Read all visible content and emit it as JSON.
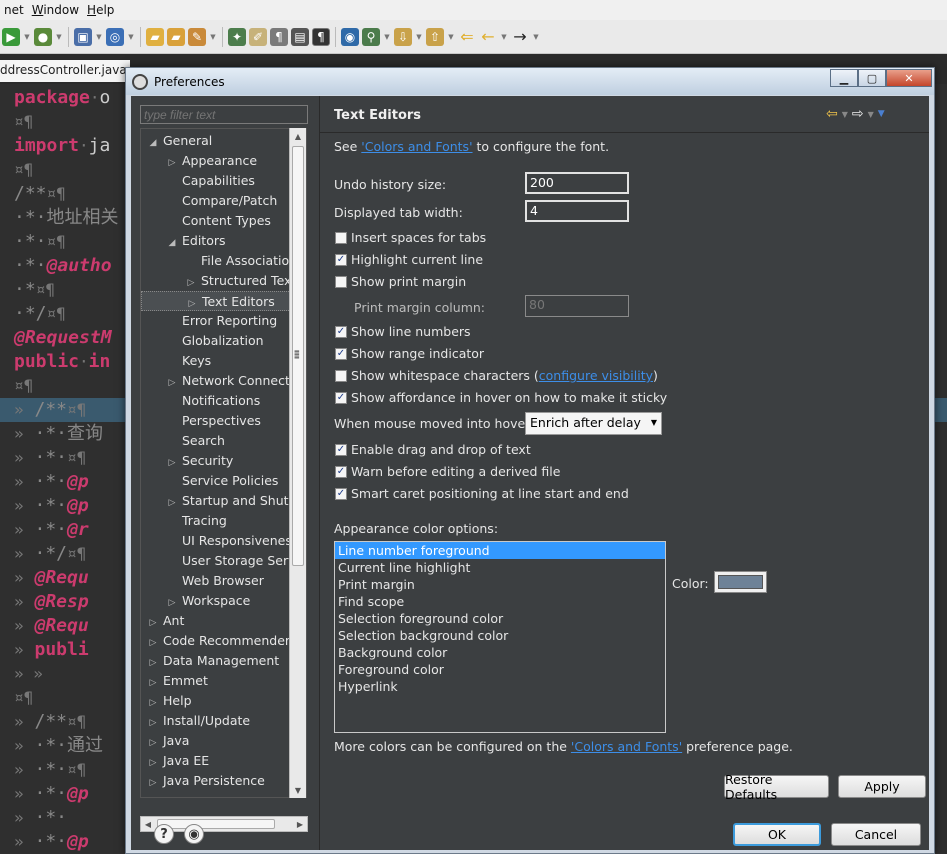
{
  "menubar": {
    "items": [
      "net",
      "Window",
      "Help"
    ]
  },
  "editor": {
    "tab_label": "ddressController.java",
    "lines": [
      {
        "parts": [
          [
            "kw",
            "package"
          ],
          [
            "para",
            "·"
          ],
          [
            "txt",
            "o"
          ]
        ]
      },
      {
        "parts": [
          [
            "para",
            "¤¶"
          ]
        ]
      },
      {
        "parts": [
          [
            "kw",
            "import"
          ],
          [
            "para",
            "·"
          ],
          [
            "txt",
            "ja"
          ]
        ]
      },
      {
        "parts": [
          [
            "para",
            "¤¶"
          ]
        ]
      },
      {
        "parts": [
          [
            "cm",
            "/**"
          ],
          [
            "para",
            "¤¶"
          ]
        ]
      },
      {
        "parts": [
          [
            "cm",
            "·*·地址相关"
          ]
        ]
      },
      {
        "parts": [
          [
            "cm",
            "·*·"
          ],
          [
            "para",
            "¤¶"
          ]
        ]
      },
      {
        "parts": [
          [
            "cm",
            "·*·"
          ],
          [
            "ann",
            "@autho"
          ]
        ]
      },
      {
        "parts": [
          [
            "cm",
            "·*"
          ],
          [
            "para",
            "¤¶"
          ]
        ]
      },
      {
        "parts": [
          [
            "cm",
            "·*/"
          ],
          [
            "para",
            "¤¶"
          ]
        ]
      },
      {
        "parts": [
          [
            "ann",
            "@RequestM"
          ]
        ]
      },
      {
        "parts": [
          [
            "kw",
            "public"
          ],
          [
            "para",
            "·"
          ],
          [
            "kw",
            "in"
          ]
        ]
      },
      {
        "parts": [
          [
            "para",
            "¤¶"
          ]
        ]
      },
      {
        "parts": [
          [
            "para",
            "»"
          ],
          [
            "cm",
            "   /**"
          ],
          [
            "para",
            "¤¶"
          ]
        ]
      },
      {
        "parts": [
          [
            "para",
            "»"
          ],
          [
            "cm",
            "    ·*·查询"
          ]
        ]
      },
      {
        "parts": [
          [
            "para",
            "»"
          ],
          [
            "cm",
            "    ·*·"
          ],
          [
            "para",
            "¤¶"
          ]
        ]
      },
      {
        "parts": [
          [
            "para",
            "»"
          ],
          [
            "cm",
            "    ·*·"
          ],
          [
            "ann",
            "@p"
          ]
        ]
      },
      {
        "parts": [
          [
            "para",
            "»"
          ],
          [
            "cm",
            "    ·*·"
          ],
          [
            "ann",
            "@p"
          ]
        ]
      },
      {
        "parts": [
          [
            "para",
            "»"
          ],
          [
            "cm",
            "    ·*·"
          ],
          [
            "ann",
            "@r"
          ]
        ]
      },
      {
        "parts": [
          [
            "para",
            "»"
          ],
          [
            "cm",
            "    ·*/"
          ],
          [
            "para",
            "¤¶"
          ]
        ]
      },
      {
        "parts": [
          [
            "para",
            "»"
          ],
          [
            "ann",
            "  @Requ"
          ]
        ]
      },
      {
        "parts": [
          [
            "para",
            "»"
          ],
          [
            "ann",
            "  @Resp"
          ]
        ]
      },
      {
        "parts": [
          [
            "para",
            "»"
          ],
          [
            "ann",
            "  @Requ"
          ]
        ]
      },
      {
        "parts": [
          [
            "para",
            "»"
          ],
          [
            "kw",
            "  publi"
          ]
        ]
      },
      {
        "parts": [
          [
            "para",
            "»     »"
          ]
        ]
      },
      {
        "parts": [
          [
            "para",
            "¤¶"
          ]
        ]
      },
      {
        "parts": [
          [
            "para",
            "»"
          ],
          [
            "cm",
            "   /**"
          ],
          [
            "para",
            "¤¶"
          ]
        ]
      },
      {
        "parts": [
          [
            "para",
            "»"
          ],
          [
            "cm",
            "    ·*·通过"
          ]
        ]
      },
      {
        "parts": [
          [
            "para",
            "»"
          ],
          [
            "cm",
            "    ·*·"
          ],
          [
            "para",
            "¤¶"
          ]
        ]
      },
      {
        "parts": [
          [
            "para",
            "»"
          ],
          [
            "cm",
            "    ·*·"
          ],
          [
            "ann",
            "@p"
          ]
        ]
      },
      {
        "parts": [
          [
            "para",
            "»"
          ],
          [
            "cm",
            "    ·*·"
          ]
        ]
      },
      {
        "parts": [
          [
            "para",
            "»"
          ],
          [
            "cm",
            "    ·*·"
          ],
          [
            "ann",
            "@p"
          ]
        ]
      }
    ]
  },
  "dialog": {
    "title": "Preferences",
    "filter_placeholder": "type filter text",
    "tree": [
      {
        "label": "General",
        "level": 0,
        "twisty": "◢"
      },
      {
        "label": "Appearance",
        "level": 1,
        "twisty": "▷"
      },
      {
        "label": "Capabilities",
        "level": 1,
        "twisty": ""
      },
      {
        "label": "Compare/Patch",
        "level": 1,
        "twisty": ""
      },
      {
        "label": "Content Types",
        "level": 1,
        "twisty": ""
      },
      {
        "label": "Editors",
        "level": 1,
        "twisty": "◢"
      },
      {
        "label": "File Associations",
        "level": 2,
        "twisty": ""
      },
      {
        "label": "Structured Text",
        "level": 2,
        "twisty": "▷"
      },
      {
        "label": "Text Editors",
        "level": 2,
        "twisty": "▷",
        "selected": true
      },
      {
        "label": "Error Reporting",
        "level": 1,
        "twisty": ""
      },
      {
        "label": "Globalization",
        "level": 1,
        "twisty": ""
      },
      {
        "label": "Keys",
        "level": 1,
        "twisty": ""
      },
      {
        "label": "Network Connections",
        "level": 1,
        "twisty": "▷"
      },
      {
        "label": "Notifications",
        "level": 1,
        "twisty": ""
      },
      {
        "label": "Perspectives",
        "level": 1,
        "twisty": ""
      },
      {
        "label": "Search",
        "level": 1,
        "twisty": ""
      },
      {
        "label": "Security",
        "level": 1,
        "twisty": "▷"
      },
      {
        "label": "Service Policies",
        "level": 1,
        "twisty": ""
      },
      {
        "label": "Startup and Shutdown",
        "level": 1,
        "twisty": "▷"
      },
      {
        "label": "Tracing",
        "level": 1,
        "twisty": ""
      },
      {
        "label": "UI Responsiveness",
        "level": 1,
        "twisty": ""
      },
      {
        "label": "User Storage Service",
        "level": 1,
        "twisty": ""
      },
      {
        "label": "Web Browser",
        "level": 1,
        "twisty": ""
      },
      {
        "label": "Workspace",
        "level": 1,
        "twisty": "▷"
      },
      {
        "label": "Ant",
        "level": 0,
        "twisty": "▷"
      },
      {
        "label": "Code Recommenders",
        "level": 0,
        "twisty": "▷"
      },
      {
        "label": "Data Management",
        "level": 0,
        "twisty": "▷"
      },
      {
        "label": "Emmet",
        "level": 0,
        "twisty": "▷"
      },
      {
        "label": "Help",
        "level": 0,
        "twisty": "▷"
      },
      {
        "label": "Install/Update",
        "level": 0,
        "twisty": "▷"
      },
      {
        "label": "Java",
        "level": 0,
        "twisty": "▷"
      },
      {
        "label": "Java EE",
        "level": 0,
        "twisty": "▷"
      },
      {
        "label": "Java Persistence",
        "level": 0,
        "twisty": "▷"
      }
    ],
    "page": {
      "title": "Text Editors",
      "see_prefix": "See ",
      "see_link": "'Colors and Fonts'",
      "see_suffix": " to configure the font.",
      "undo_label": "Undo history size:",
      "undo_value": "200",
      "tabwidth_label": "Displayed tab width:",
      "tabwidth_value": "4",
      "checks": [
        {
          "label": "Insert spaces for tabs",
          "checked": false
        },
        {
          "label": "Highlight current line",
          "checked": true
        },
        {
          "label": "Show print margin",
          "checked": false
        }
      ],
      "print_margin_label": "Print margin column:",
      "print_margin_value": "80",
      "checks2": [
        {
          "label": "Show line numbers",
          "checked": true
        },
        {
          "label": "Show range indicator",
          "checked": true
        }
      ],
      "whitespace_label": "Show whitespace characters (",
      "whitespace_link": "configure visibility",
      "whitespace_close": ")",
      "affordance_label": "Show affordance in hover on how to make it sticky",
      "hover_label": "When mouse moved into hover:",
      "hover_value": "Enrich after delay",
      "checks3": [
        {
          "label": "Enable drag and drop of text",
          "checked": true
        },
        {
          "label": "Warn before editing a derived file",
          "checked": true
        },
        {
          "label": "Smart caret positioning at line start and end",
          "checked": true
        }
      ],
      "appearance_label": "Appearance color options:",
      "color_options": [
        "Line number foreground",
        "Current line highlight",
        "Print margin",
        "Find scope",
        "Selection foreground color",
        "Selection background color",
        "Background color",
        "Foreground color",
        "Hyperlink"
      ],
      "color_label": "Color:",
      "color_value": "#6e8297",
      "more_prefix": "More colors can be configured on the ",
      "more_link": "'Colors and Fonts'",
      "more_suffix": " preference page.",
      "restore_label": "Restore Defaults",
      "apply_label": "Apply"
    },
    "ok_label": "OK",
    "cancel_label": "Cancel"
  }
}
